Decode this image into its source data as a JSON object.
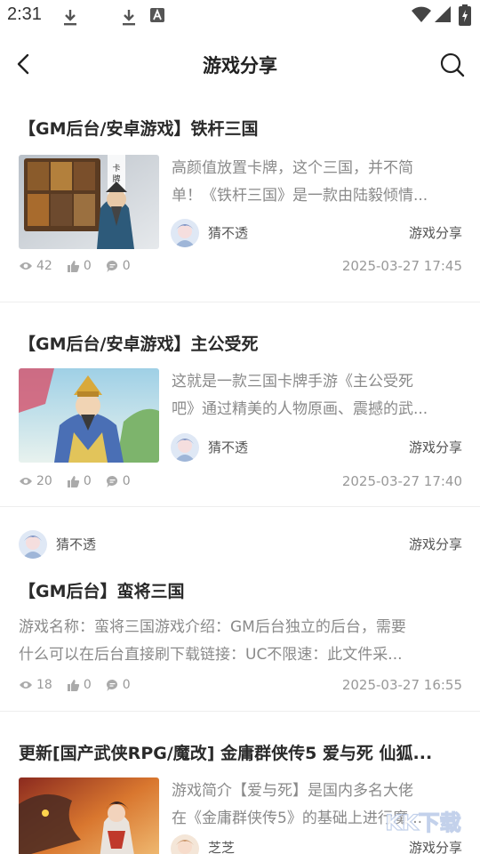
{
  "status_bar": {
    "time": "2:31"
  },
  "header": {
    "title": "游戏分享"
  },
  "articles": [
    {
      "title": "【GM后台/安卓游戏】铁杆三国",
      "summary_line1": "高颜值放置卡牌，这个三国，并不简",
      "summary_line2": "单！《铁杆三国》是一款由陆毅倾情...",
      "author": "猜不透",
      "category": "游戏分享",
      "views": "42",
      "likes": "0",
      "comments": "0",
      "date": "2025-03-27 17:45",
      "thumb_caption": "卡牌巅峰"
    },
    {
      "title": "【GM后台/安卓游戏】主公受死",
      "summary_line1": "这就是一款三国卡牌手游《主公受死",
      "summary_line2": "吧》通过精美的人物原画、震撼的武...",
      "author": "猜不透",
      "category": "游戏分享",
      "views": "20",
      "likes": "0",
      "comments": "0",
      "date": "2025-03-27 17:40"
    },
    {
      "title": "【GM后台】蛮将三国",
      "summary_line1": "游戏名称：蛮将三国游戏介绍：GM后台独立的后台，需要",
      "summary_line2": "什么可以在后台直接刷下载链接：UC不限速：此文件采...",
      "author": "猜不透",
      "category": "游戏分享",
      "views": "18",
      "likes": "0",
      "comments": "0",
      "date": "2025-03-27 16:55"
    },
    {
      "title": "更新[国产武侠RPG/魔改] 金庸群侠传5 爱与死 仙狐...",
      "summary_line1": "游戏简介【爱与死】是国内多名大佬",
      "summary_line2": "在《金庸群侠传5》的基础上进行魔...",
      "author": "芝芝",
      "category": "游戏分享"
    }
  ],
  "watermark": {
    "text": "KK下载"
  },
  "colors": {
    "text_primary": "#222222",
    "text_secondary": "#8a8a8a",
    "meta": "#999999"
  }
}
